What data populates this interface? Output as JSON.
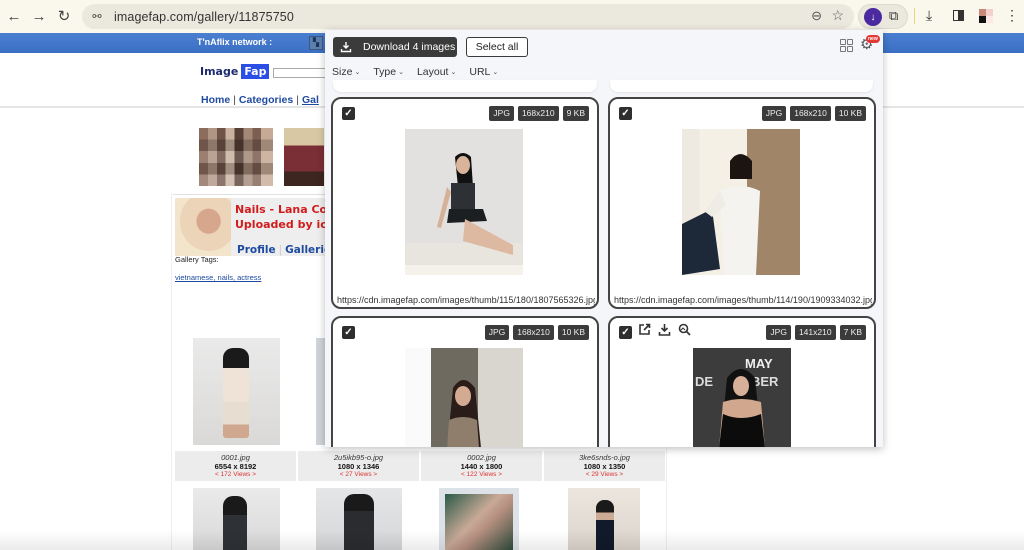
{
  "browser": {
    "url": "imagefap.com/gallery/11875750",
    "icons": {
      "back": "arrow-left-icon",
      "forward": "arrow-right-icon",
      "reload": "reload-icon",
      "site_info": "tune-icon",
      "zoom": "zoom-out-icon",
      "bookmark": "star-icon",
      "extension": "download-extension-icon",
      "extensions_menu": "puzzle-icon",
      "downloads": "download-icon",
      "side_panel": "side-panel-icon",
      "profile": "avatar",
      "menu": "kebab-menu-icon"
    },
    "glyphs": {
      "back": "←",
      "forward": "→",
      "reload": "↻",
      "site_info": "⚯",
      "zoom": "⊖",
      "bookmark": "☆",
      "ext_download": "↓",
      "puzzle": "⧉",
      "downloads": "⤓",
      "menu": "⋮"
    }
  },
  "site": {
    "network_label": "T'nAflix network :",
    "logo_image": "Image",
    "logo_fap": "Fap",
    "nav": {
      "home": "Home",
      "categories": "Categories",
      "galleries": "Gal",
      "sep": "|"
    },
    "gallery": {
      "title": "Nails - Lana Co",
      "uploader": "Uploaded by ica",
      "profile_link": "Profile",
      "galleries_link": "Galleries",
      "link_sep": "|",
      "tags_label": "Gallery Tags:",
      "tags": "vietnamese, nails, actress"
    },
    "images": [
      {
        "filename": "0001.jpg",
        "dims": "6554 x 8192",
        "views": "< 172 Views >"
      },
      {
        "filename": "2u5ikb95-o.jpg",
        "dims": "1080 x 1346",
        "views": "< 27 Views >"
      },
      {
        "filename": "0002.jpg",
        "dims": "1440 x 1800",
        "views": "< 122 Views >"
      },
      {
        "filename": "3ke6snds-o.jpg",
        "dims": "1080 x 1350",
        "views": "< 29 Views >"
      }
    ]
  },
  "popup": {
    "download_button": "Download 4 images",
    "select_all_button": "Select all",
    "new_badge": "new",
    "gear_glyph": "⚙",
    "filters": [
      {
        "label": "Size"
      },
      {
        "label": "Type"
      },
      {
        "label": "Layout"
      },
      {
        "label": "URL"
      }
    ],
    "chevron": "⌄",
    "check_glyph": "✓",
    "tool_glyphs": {
      "open": "⧉",
      "download": "⤓",
      "search": "🔍︎"
    },
    "cards": [
      {
        "checked": true,
        "type": "JPG",
        "size": "168x210",
        "filesize": "9 KB",
        "url": "https://cdn.imagefap.com/images/thumb/115/180/1807565326.jpg"
      },
      {
        "checked": true,
        "type": "JPG",
        "size": "168x210",
        "filesize": "10 KB",
        "url": "https://cdn.imagefap.com/images/thumb/114/190/1909334032.jpg"
      },
      {
        "checked": true,
        "type": "JPG",
        "size": "168x210",
        "filesize": "10 KB",
        "url": ""
      },
      {
        "checked": true,
        "type": "JPG",
        "size": "141x210",
        "filesize": "7 KB",
        "url": "",
        "hovered": true
      }
    ]
  }
}
